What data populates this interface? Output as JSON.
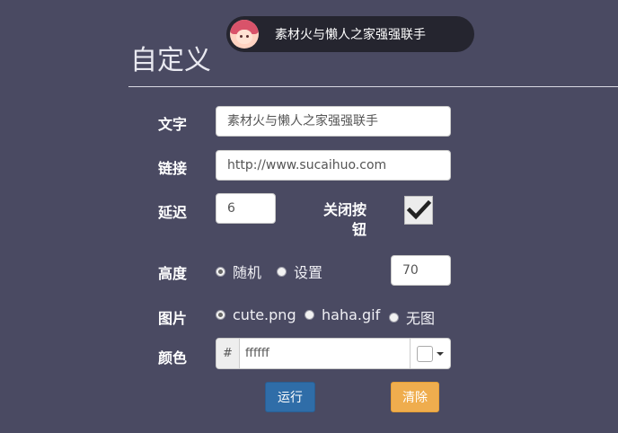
{
  "page_title": "自定义",
  "barrage_preview": {
    "text": "素材火与懒人之家强强联手"
  },
  "form": {
    "text_label": "文字",
    "text_value": "素材火与懒人之家强强联手",
    "link_label": "链接",
    "link_value": "http://www.sucaihuo.com",
    "delay_label": "延迟",
    "delay_value": "6",
    "close_button_label": "关闭按钮",
    "close_button_checked": true,
    "height_label": "高度",
    "height_options": [
      "随机",
      "设置"
    ],
    "height_selected": "随机",
    "height_value": "70",
    "image_label": "图片",
    "image_options": [
      "cute.png",
      "haha.gif",
      "无图"
    ],
    "image_selected": "cute.png",
    "color_label": "颜色",
    "color_prefix": "#",
    "color_value": "ffffff",
    "color_swatch": "#ffffff"
  },
  "buttons": {
    "run": "运行",
    "clear": "清除"
  },
  "colors": {
    "background": "#4a4a62",
    "run_button": "#2f6da8",
    "clear_button": "#efad4e",
    "barrage_bg": "#25252f"
  }
}
